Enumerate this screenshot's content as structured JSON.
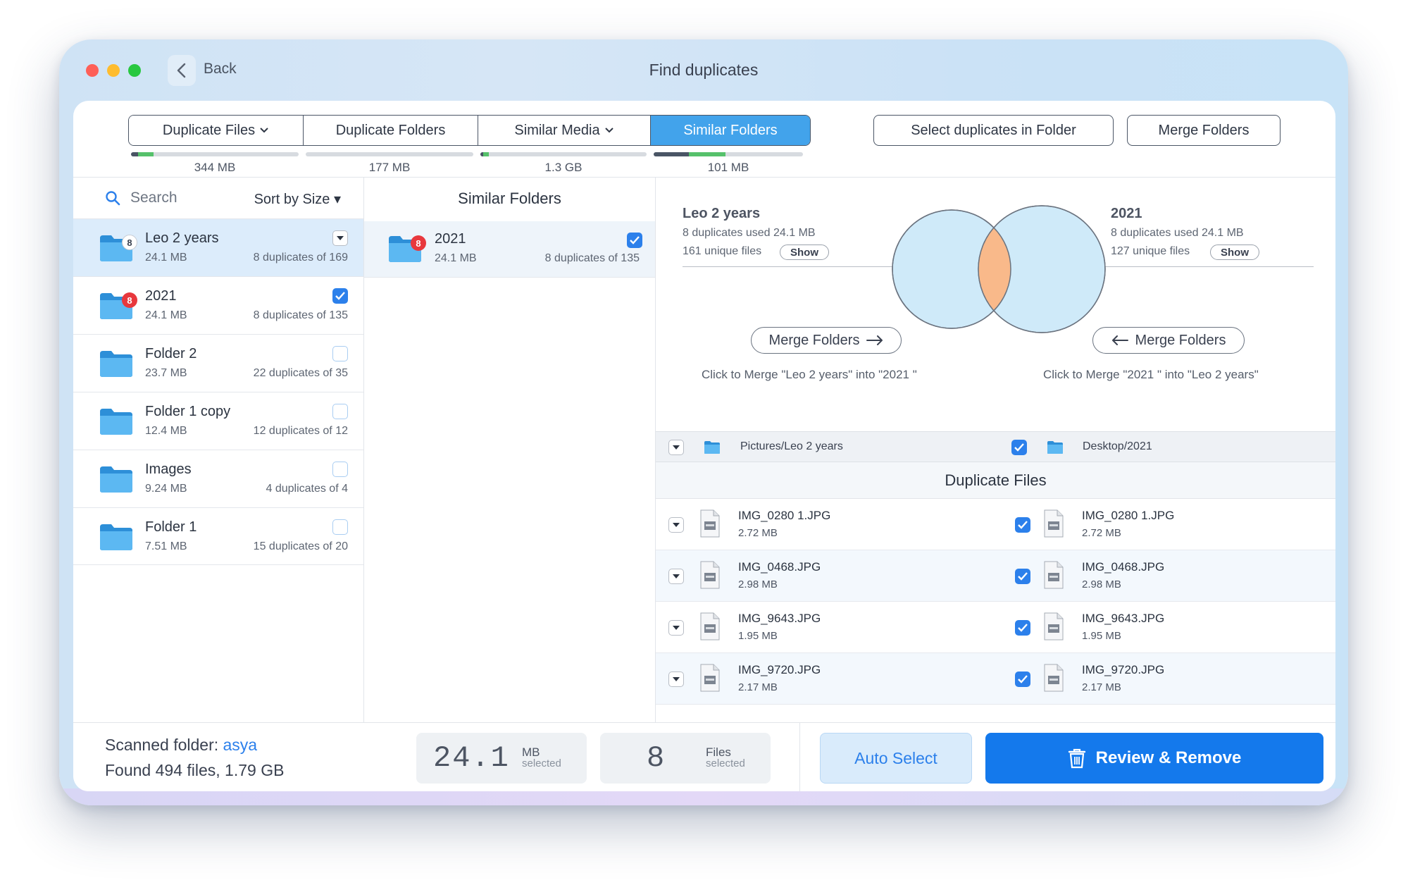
{
  "window": {
    "title": "Find duplicates",
    "back_label": "Back"
  },
  "tabs": [
    {
      "label": "Duplicate Files",
      "size": "344 MB",
      "dropdown": true
    },
    {
      "label": "Duplicate Folders",
      "size": "177 MB",
      "dropdown": false
    },
    {
      "label": "Similar Media",
      "size": "1.3 GB",
      "dropdown": true
    },
    {
      "label": "Similar Folders",
      "size": "101 MB",
      "dropdown": false,
      "active": true
    }
  ],
  "toolbar": {
    "select_in_folder": "Select duplicates in Folder",
    "merge_folders": "Merge Folders"
  },
  "left_panel": {
    "search_placeholder": "Search",
    "sort_label": "Sort by Size ▾",
    "folders": [
      {
        "name": "Leo 2 years",
        "size": "24.1 MB",
        "dups": "8 duplicates of 169",
        "badge": "8",
        "badge_style": "white",
        "selected": true,
        "control": "dropdown"
      },
      {
        "name": "2021",
        "size": "24.1 MB",
        "dups": "8 duplicates of 135",
        "badge": "8",
        "badge_style": "red",
        "checked": true
      },
      {
        "name": "Folder 2",
        "size": "23.7 MB",
        "dups": "22 duplicates of 35",
        "checked": false
      },
      {
        "name": "Folder 1 copy",
        "size": "12.4 MB",
        "dups": "12 duplicates of 12",
        "checked": false
      },
      {
        "name": "Images",
        "size": "9.24 MB",
        "dups": "4 duplicates of 4",
        "checked": false
      },
      {
        "name": "Folder 1",
        "size": "7.51 MB",
        "dups": "15 duplicates of 20",
        "checked": false
      }
    ]
  },
  "middle_panel": {
    "title": "Similar Folders",
    "item": {
      "name": "2021",
      "size": "24.1 MB",
      "dups": "8 duplicates of 135",
      "badge": "8",
      "checked": true
    }
  },
  "compare": {
    "left": {
      "name": "Leo 2 years",
      "line1": "8 duplicates used 24.1 MB",
      "line2": "161 unique files",
      "show": "Show"
    },
    "right": {
      "name": "2021",
      "line1": "8 duplicates used 24.1 MB",
      "line2": "127 unique files",
      "show": "Show"
    },
    "merge_left_label": "Merge Folders",
    "merge_right_label": "Merge Folders",
    "merge_left_caption": "Click to Merge \"Leo 2 years\" into \"2021 \"",
    "merge_right_caption": "Click to Merge \"2021 \" into \"Leo 2 years\"",
    "path_left": "Pictures/Leo 2 years",
    "path_right": "Desktop/2021",
    "dup_title": "Duplicate Files",
    "files": [
      {
        "name": "IMG_0280 1.JPG",
        "size": "2.72 MB",
        "checked": true
      },
      {
        "name": "IMG_0468.JPG",
        "size": "2.98 MB",
        "checked": true
      },
      {
        "name": "IMG_9643.JPG",
        "size": "1.95 MB",
        "checked": true
      },
      {
        "name": "IMG_9720.JPG",
        "size": "2.17 MB",
        "checked": true
      }
    ]
  },
  "footer": {
    "scanned_prefix": "Scanned folder: ",
    "scanned_folder": "asya",
    "found": "Found 494 files, 1.79 GB",
    "size_value": "24.1",
    "size_unit": "MB",
    "size_sub": "selected",
    "files_value": "8",
    "files_unit": "Files",
    "files_sub": "selected",
    "auto_select": "Auto Select",
    "review_remove": "Review & Remove"
  },
  "colors": {
    "accent": "#2c80eb",
    "tab_active": "#42a3eb",
    "primary_button": "#1479ec",
    "venn_fill": "#cfeaf9",
    "venn_overlap": "#f9b98a",
    "badge_red": "#e8383d"
  }
}
